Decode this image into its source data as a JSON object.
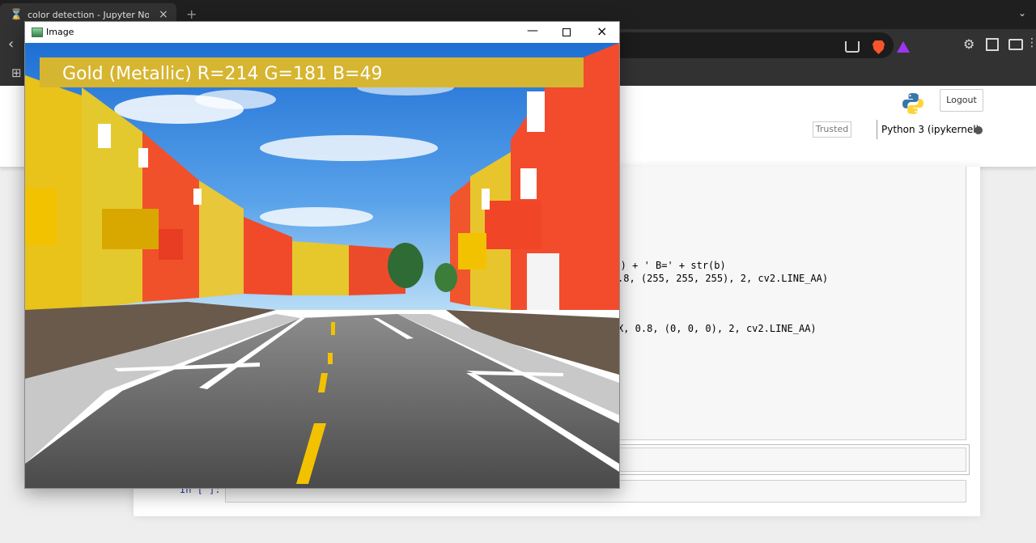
{
  "browser": {
    "tab_title": "color detection - Jupyter Notebook",
    "tab_close": "×",
    "new_tab": "+",
    "tabs_menu": "⌄",
    "back": "‹",
    "extensions": "⚙",
    "menu": "⋮",
    "apps": "⊞"
  },
  "jupyter": {
    "logout_label": "Logout",
    "trusted_label": "Trusted",
    "kernel_name": "Python 3 (ipykernel)",
    "code_lines": [
      "r(g) + ' B=' + str(b)",
      ".8, (255, 255, 255), 2, cv2.LINE_AA)",
      "X, 0.8, (0, 0, 0), 2, cv2.LINE_AA)"
    ],
    "input_prompt": "In [ ]:"
  },
  "image_window": {
    "title": "Image",
    "minimize": "—",
    "close": "×",
    "color_label": "Gold (Metallic) R=214 G=181 B=49",
    "banner_color": "#d6b531"
  },
  "colors": {
    "tab_bar": "#1f1f1f",
    "toolbar": "#323232",
    "page_bg": "#eeeeee",
    "brave": "#fb542b"
  }
}
